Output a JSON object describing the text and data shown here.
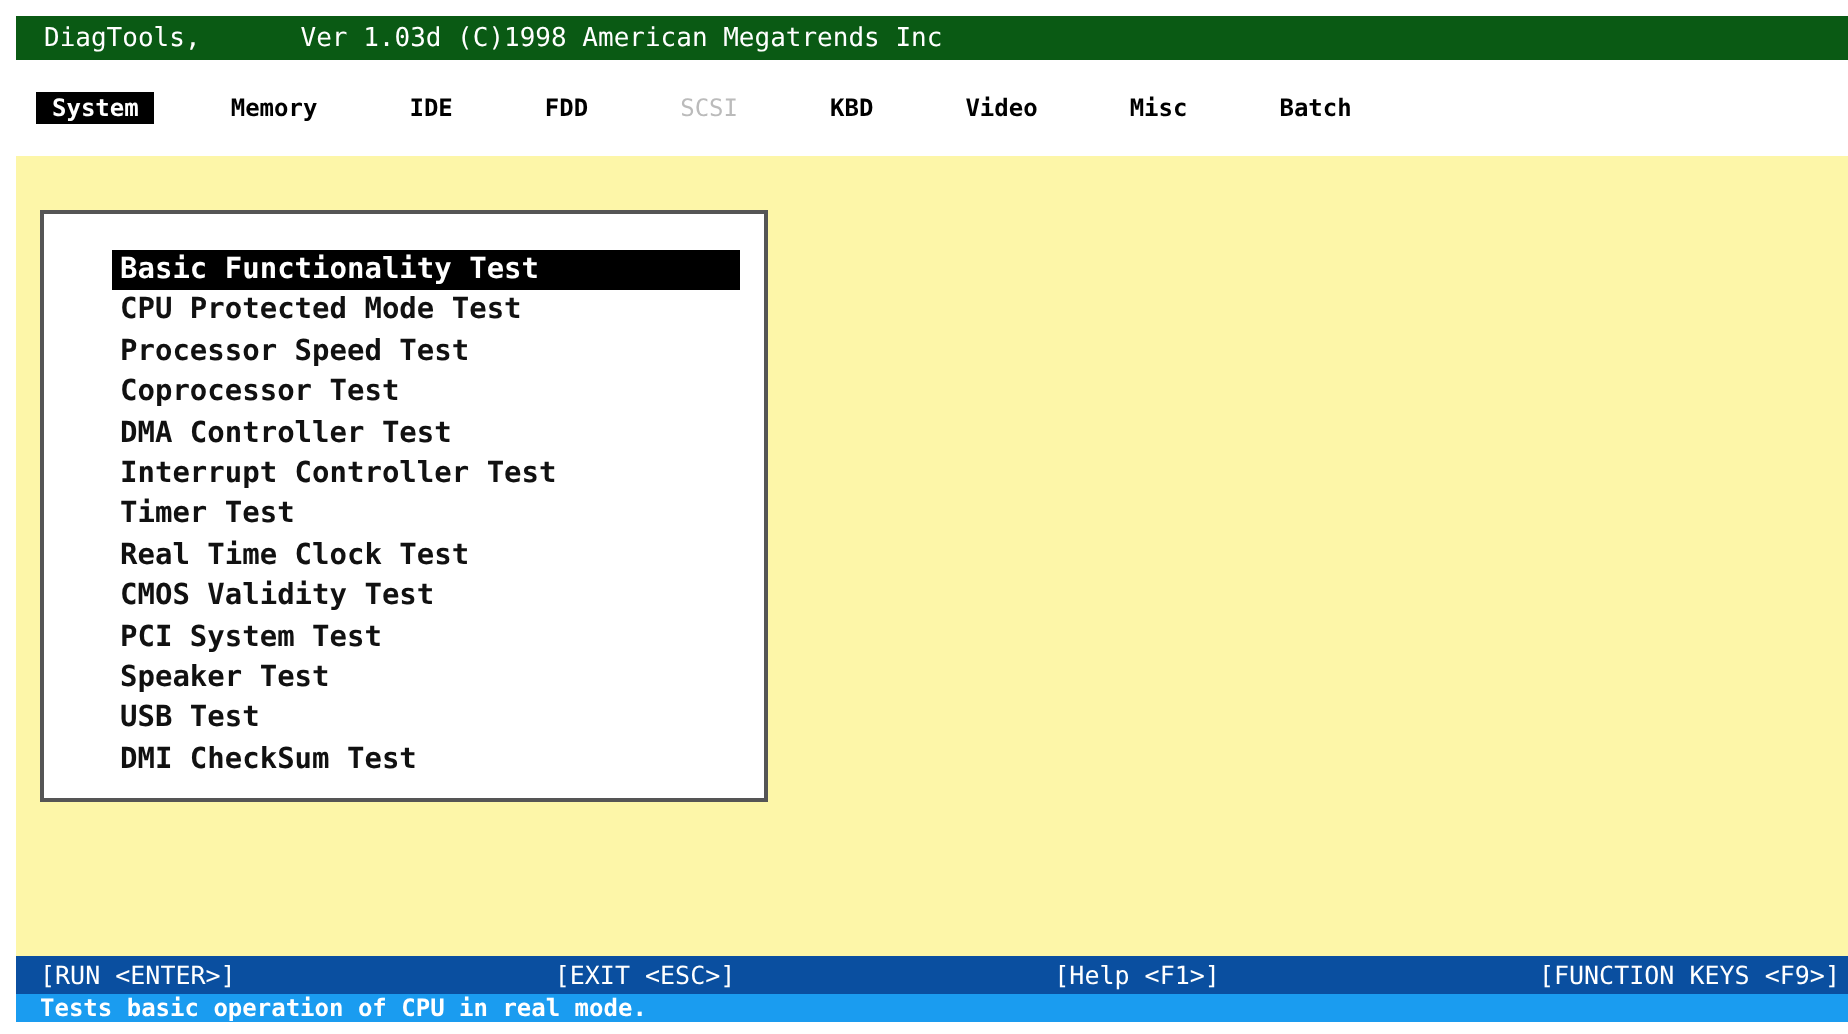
{
  "window": {
    "title": "DiagTools,",
    "version": "Ver 1.03d (C)1998 American Megatrends Inc"
  },
  "menu": [
    {
      "label": "System",
      "selected": true,
      "disabled": false
    },
    {
      "label": "Memory",
      "selected": false,
      "disabled": false
    },
    {
      "label": "IDE",
      "selected": false,
      "disabled": false
    },
    {
      "label": "FDD",
      "selected": false,
      "disabled": false
    },
    {
      "label": "SCSI",
      "selected": false,
      "disabled": true
    },
    {
      "label": "KBD",
      "selected": false,
      "disabled": false
    },
    {
      "label": "Video",
      "selected": false,
      "disabled": false
    },
    {
      "label": "Misc",
      "selected": false,
      "disabled": false
    },
    {
      "label": "Batch",
      "selected": false,
      "disabled": false
    }
  ],
  "tests": [
    {
      "label": "Basic Functionality Test",
      "selected": true
    },
    {
      "label": "CPU Protected Mode Test",
      "selected": false
    },
    {
      "label": "Processor Speed Test",
      "selected": false
    },
    {
      "label": "Coprocessor Test",
      "selected": false
    },
    {
      "label": "DMA Controller Test",
      "selected": false
    },
    {
      "label": "Interrupt Controller Test",
      "selected": false
    },
    {
      "label": "Timer Test",
      "selected": false
    },
    {
      "label": "Real Time Clock Test",
      "selected": false
    },
    {
      "label": "CMOS Validity Test",
      "selected": false
    },
    {
      "label": "PCI System Test",
      "selected": false
    },
    {
      "label": "Speaker Test",
      "selected": false
    },
    {
      "label": "USB Test",
      "selected": false
    },
    {
      "label": "DMI CheckSum Test",
      "selected": false
    }
  ],
  "key_bar": [
    "[RUN <ENTER>]",
    "[EXIT <ESC>]",
    "[Help <F1>]",
    "[FUNCTION KEYS <F9>]"
  ],
  "status_bar": "Tests basic operation of CPU in real mode."
}
